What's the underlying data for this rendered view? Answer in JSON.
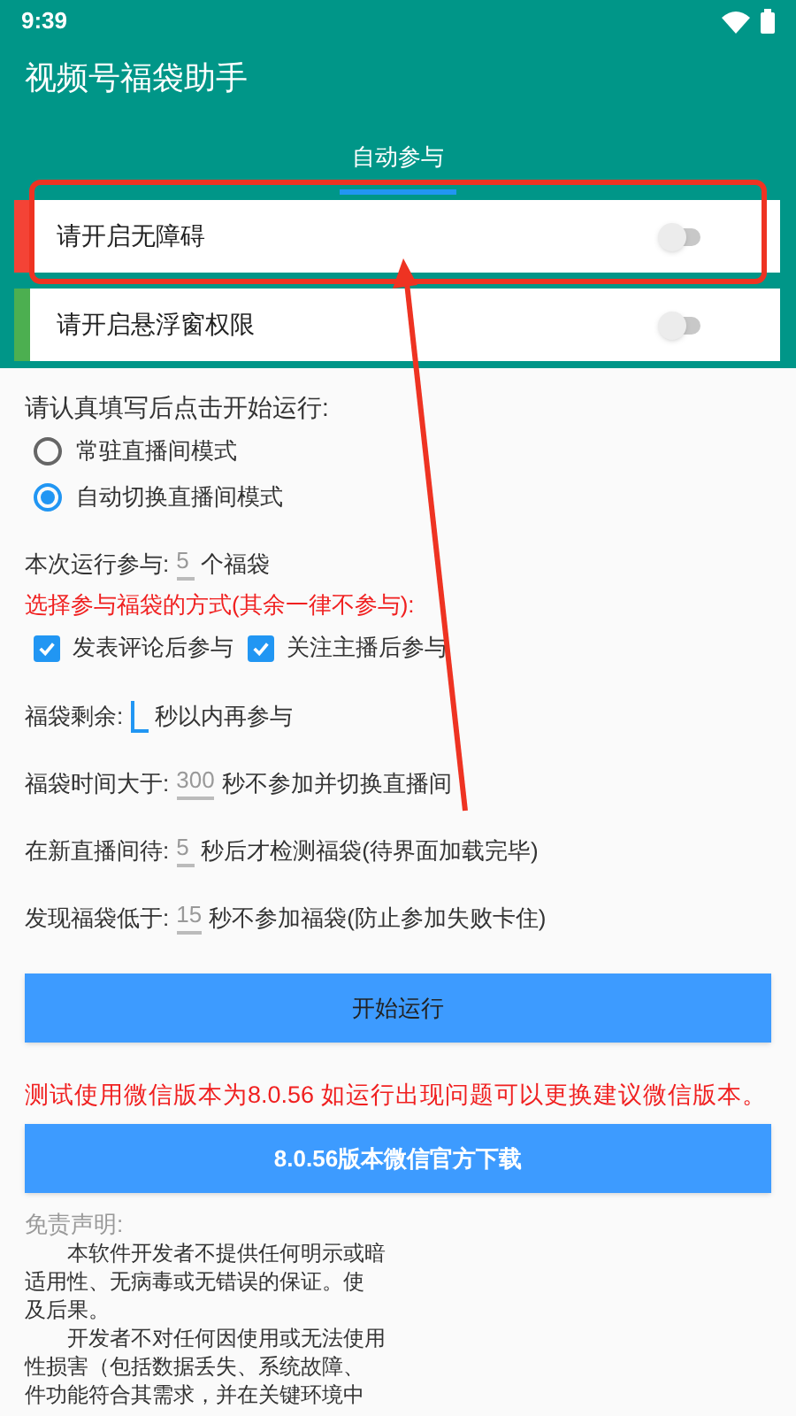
{
  "status_bar": {
    "time": "9:39"
  },
  "app_bar": {
    "title": "视频号福袋助手"
  },
  "tabs": [
    {
      "label": "自动参与",
      "selected": true
    }
  ],
  "permissions": [
    {
      "label": "请开启无障碍",
      "color": "#f44336",
      "on": false
    },
    {
      "label": "请开启悬浮窗权限",
      "color": "#4caf50",
      "on": false
    }
  ],
  "form": {
    "intro": "请认真填写后点击开始运行:",
    "modes": [
      {
        "label": "常驻直播间模式",
        "selected": false
      },
      {
        "label": "自动切换直播间模式",
        "selected": true
      }
    ],
    "participation": {
      "prefix": "本次运行参与:",
      "value": "5",
      "suffix": "个福袋",
      "focused": false
    },
    "method_hint": "选择参与福袋的方式(其余一律不参与):",
    "methods": [
      {
        "label": "发表评论后参与",
        "checked": true
      },
      {
        "label": "关注主播后参与",
        "checked": true
      }
    ],
    "timing": [
      {
        "prefix": "福袋剩余:",
        "suffix": "秒以内再参与",
        "focused": true
      },
      {
        "prefix": "福袋时间大于:",
        "value": "300",
        "suffix": "秒不参加并切换直播间",
        "focused": false
      },
      {
        "prefix": "在新直播间待:",
        "value": "5",
        "suffix": "秒后才检测福袋(待界面加载完毕)",
        "focused": false
      },
      {
        "prefix": "发现福袋低于:",
        "value": "15",
        "suffix": "秒不参加福袋(防止参加失败卡住)",
        "focused": false
      }
    ]
  },
  "start_button": "开始运行",
  "version_notice": "测试使用微信版本为8.0.56 如运行出现问题可以更换建议微信版本。",
  "download_button": "8.0.56版本微信官方下载",
  "disclaimer": {
    "title": "免责声明:",
    "lines": [
      "　　本软件开发者不提供任何明示或暗",
      "适用性、无病毒或无错误的保证。使",
      "及后果。",
      "　　开发者不对任何因使用或无法使用",
      "性损害（包括数据丢失、系统故障、",
      "件功能符合其需求，并在关键环境中"
    ]
  }
}
